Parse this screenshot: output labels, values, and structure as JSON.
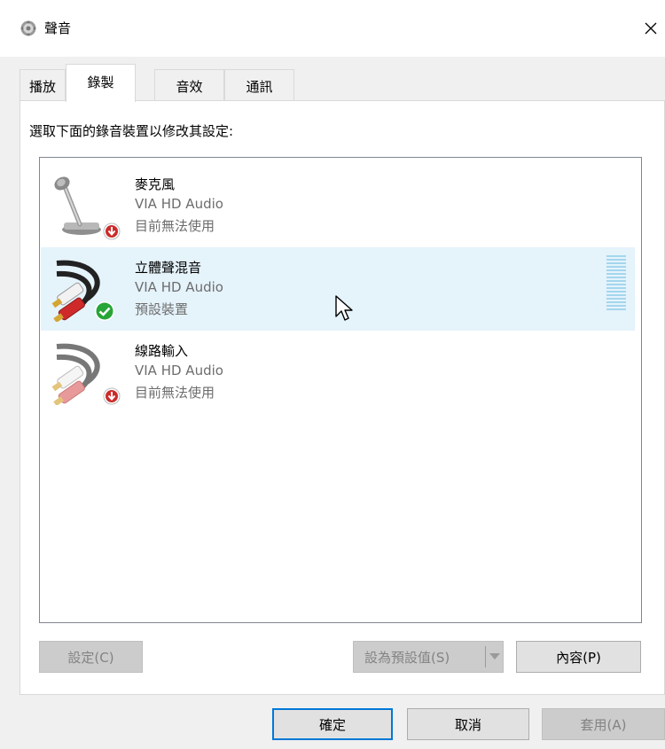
{
  "window": {
    "title": "聲音",
    "icon": "speaker-gear-icon",
    "close_icon": "close-icon"
  },
  "tabs": [
    {
      "label": "播放",
      "active": false
    },
    {
      "label": "錄製",
      "active": true
    },
    {
      "label": "音效",
      "active": false
    },
    {
      "label": "通訊",
      "active": false
    }
  ],
  "instruction": "選取下面的錄音裝置以修改其設定:",
  "devices": [
    {
      "name": "麥克風",
      "driver": "VIA HD Audio",
      "status": "目前無法使用",
      "icon": "microphone-icon",
      "badge": "down-arrow-red-badge-icon",
      "selected": false
    },
    {
      "name": "立體聲混音",
      "driver": "VIA HD Audio",
      "status": "預設裝置",
      "icon": "rca-cable-icon",
      "badge": "green-check-badge-icon",
      "selected": true
    },
    {
      "name": "線路輸入",
      "driver": "VIA HD Audio",
      "status": "目前無法使用",
      "icon": "rca-cable-icon",
      "badge": "down-arrow-red-badge-icon",
      "selected": false
    }
  ],
  "buttons": {
    "configure": "設定(C)",
    "set_default": "設為預設值(S)",
    "properties": "內容(P)",
    "ok": "確定",
    "cancel": "取消",
    "apply": "套用(A)"
  },
  "colors": {
    "selection": "#e5f3fb",
    "meter": "#a4d6ee",
    "default_button_border": "#0078d7"
  }
}
